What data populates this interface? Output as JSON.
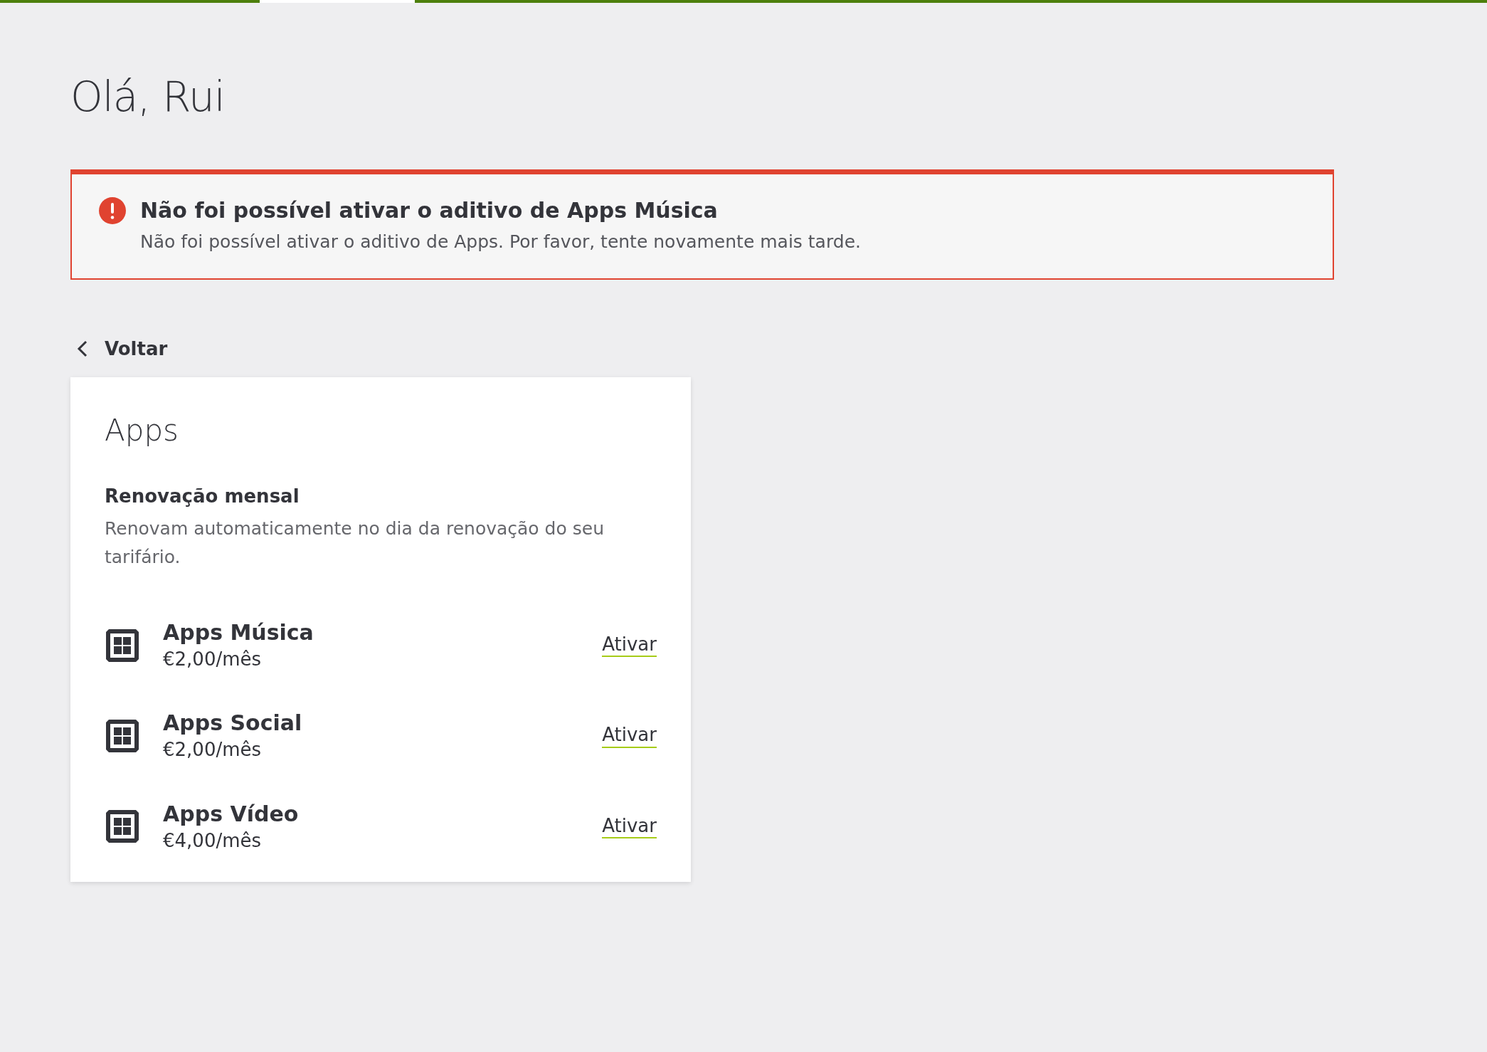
{
  "greeting": "Olá, Rui",
  "alert": {
    "title": "Não foi possível ativar o aditivo de Apps Música",
    "message": "Não foi possível ativar o aditivo de Apps. Por favor, tente novamente mais tarde."
  },
  "back_link": {
    "label": "Voltar"
  },
  "card": {
    "title": "Apps",
    "section_title": "Renovação mensal",
    "section_description": "Renovam automaticamente no dia da renovação do seu tarifário.",
    "items": [
      {
        "name": "Apps Música",
        "price": "€2,00/mês",
        "action": "Ativar"
      },
      {
        "name": "Apps Social",
        "price": "€2,00/mês",
        "action": "Ativar"
      },
      {
        "name": "Apps Vídeo",
        "price": "€4,00/mês",
        "action": "Ativar"
      }
    ]
  }
}
